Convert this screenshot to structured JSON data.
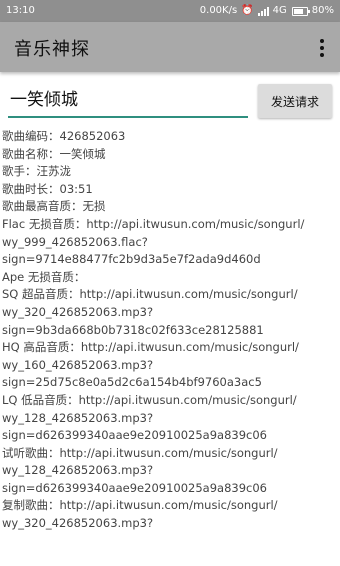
{
  "status_bar": {
    "time": "13:10",
    "network_speed": "0.00K/s",
    "alarm_icon": "alarm-clock-icon",
    "signal_icon": "signal-bars-icon",
    "network_type": "4G",
    "battery_icon": "battery-icon",
    "battery_percent": "80%",
    "battery_level": 0.8
  },
  "app_bar": {
    "title": "音乐神探",
    "menu_icon": "overflow-menu-icon"
  },
  "search": {
    "value": "一笑倾城",
    "send_label": "发送请求"
  },
  "colors": {
    "status_bar": "#8f8f8f",
    "app_bar": "#a9a9a9",
    "accent": "#2f8f7f",
    "button": "#dcdcdc",
    "result_text": "#444444"
  },
  "result_lines": [
    "歌曲编码：426852063",
    "歌曲名称：一笑倾城",
    "歌手：汪苏泷",
    "歌曲时长：03:51",
    "歌曲最高音质：无损",
    "Flac 无损音质：http://api.itwusun.com/music/songurl/",
    "wy_999_426852063.flac?",
    "sign=9714e88477fc2b9d3a5e7f2ada9d460d",
    "Ape 无损音质：",
    "SQ 超品音质：http://api.itwusun.com/music/songurl/",
    "wy_320_426852063.mp3?",
    "sign=9b3da668b0b7318c02f633ce28125881",
    "HQ 高品音质：http://api.itwusun.com/music/songurl/",
    "wy_160_426852063.mp3?",
    "sign=25d75c8e0a5d2c6a154b4bf9760a3ac5",
    "LQ 低品音质：http://api.itwusun.com/music/songurl/",
    "wy_128_426852063.mp3?",
    "sign=d626399340aae9e20910025a9a839c06",
    "试听歌曲：http://api.itwusun.com/music/songurl/",
    "wy_128_426852063.mp3?",
    "sign=d626399340aae9e20910025a9a839c06",
    "复制歌曲：http://api.itwusun.com/music/songurl/",
    "wy_320_426852063.mp3?"
  ]
}
